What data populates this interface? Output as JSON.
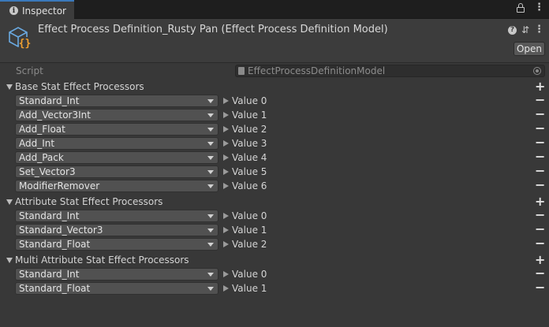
{
  "tab": {
    "label": "Inspector"
  },
  "header": {
    "title": "Effect Process Definition_Rusty Pan (Effect Process Definition Model)",
    "open_label": "Open"
  },
  "script": {
    "label": "Script",
    "value": "EffectProcessDefinitionModel"
  },
  "sections": [
    {
      "title": "Base Stat Effect Processors",
      "items": [
        {
          "type": "Standard_Int",
          "value_label": "Value 0"
        },
        {
          "type": "Add_Vector3Int",
          "value_label": "Value 1"
        },
        {
          "type": "Add_Float",
          "value_label": "Value 2"
        },
        {
          "type": "Add_Int",
          "value_label": "Value 3"
        },
        {
          "type": "Add_Pack",
          "value_label": "Value 4"
        },
        {
          "type": "Set_Vector3",
          "value_label": "Value 5"
        },
        {
          "type": "ModifierRemover",
          "value_label": "Value 6"
        }
      ]
    },
    {
      "title": "Attribute Stat Effect Processors",
      "items": [
        {
          "type": "Standard_Int",
          "value_label": "Value 0"
        },
        {
          "type": "Standard_Vector3",
          "value_label": "Value 1"
        },
        {
          "type": "Standard_Float",
          "value_label": "Value 2"
        }
      ]
    },
    {
      "title": "Multi Attribute Stat Effect Processors",
      "items": [
        {
          "type": "Standard_Int",
          "value_label": "Value 0"
        },
        {
          "type": "Standard_Float",
          "value_label": "Value 1"
        }
      ]
    }
  ],
  "colors": {
    "background": "#383838",
    "tabbar": "#1e1e1e",
    "accent": "#3a79bb",
    "dropdown": "#515151"
  },
  "icons": {
    "tab": "info-icon",
    "tabbar": [
      "lock-icon",
      "menu-dots-icon"
    ],
    "asset": "scriptable-object-icon",
    "header": [
      "help-icon",
      "sliders-icon",
      "menu-dots-icon"
    ]
  }
}
